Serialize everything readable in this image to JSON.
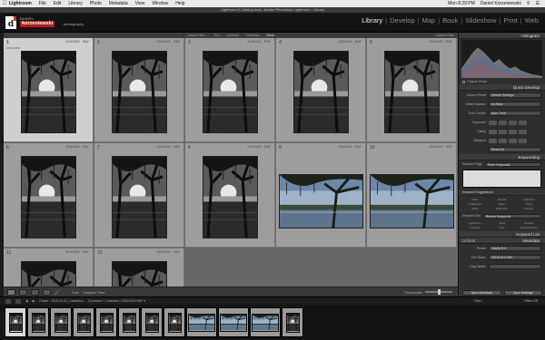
{
  "menubar": {
    "items": [
      {
        "label": "Lightroom",
        "bold": true
      },
      {
        "label": "File"
      },
      {
        "label": "Edit"
      },
      {
        "label": "Library"
      },
      {
        "label": "Photo"
      },
      {
        "label": "Metadata"
      },
      {
        "label": "View"
      },
      {
        "label": "Window"
      },
      {
        "label": "Help"
      }
    ],
    "clock": "Mon 8:29 PM",
    "user": "Daniel Korzeniewski"
  },
  "window": {
    "title": "Lightroom 6 Catalog.lrcat - Adobe Photoshop Lightroom - Library"
  },
  "identity": {
    "logo_letter": "d",
    "brand_top": "DANIEL",
    "brand_name": "korzeniewski",
    "brand_sub": "photography"
  },
  "modules": [
    "Library",
    "Develop",
    "Map",
    "Book",
    "Slideshow",
    "Print",
    "Web"
  ],
  "active_module": "Library",
  "filterbar": {
    "label": "Library Filter :",
    "tabs": [
      "Text",
      "Attribute",
      "Metadata",
      "None"
    ],
    "preset": "Custom Filter"
  },
  "grid": {
    "cells": [
      {
        "index": "1",
        "fname": "20151001",
        "ext": "RAF",
        "dims": "2000x3000",
        "orientation": "portrait",
        "selected": true
      },
      {
        "index": "2",
        "fname": "20151001",
        "ext": "RAF",
        "dims": "",
        "orientation": "portrait",
        "selected": false
      },
      {
        "index": "3",
        "fname": "20151001",
        "ext": "RAF",
        "dims": "",
        "orientation": "portrait",
        "selected": false
      },
      {
        "index": "4",
        "fname": "20151001",
        "ext": "RAF",
        "dims": "",
        "orientation": "portrait",
        "selected": false
      },
      {
        "index": "5",
        "fname": "20151001",
        "ext": "RAF",
        "dims": "",
        "orientation": "portrait",
        "selected": false
      },
      {
        "index": "6",
        "fname": "20151001",
        "ext": "RAF",
        "dims": "",
        "orientation": "portrait",
        "selected": false
      },
      {
        "index": "7",
        "fname": "20151001",
        "ext": "RAF",
        "dims": "",
        "orientation": "portrait",
        "selected": false
      },
      {
        "index": "8",
        "fname": "20151001",
        "ext": "RAF",
        "dims": "",
        "orientation": "portrait",
        "selected": false
      },
      {
        "index": "9",
        "fname": "20151001",
        "ext": "RAF",
        "dims": "",
        "orientation": "landscape",
        "selected": false
      },
      {
        "index": "10",
        "fname": "20151001",
        "ext": "RAF",
        "dims": "",
        "orientation": "landscape",
        "selected": false
      },
      {
        "index": "11",
        "fname": "20151001",
        "ext": "RAF",
        "dims": "",
        "orientation": "portrait",
        "selected": false
      },
      {
        "index": "12",
        "fname": "20151001",
        "ext": "RAF",
        "dims": "",
        "orientation": "portrait",
        "selected": false
      }
    ],
    "stars": "· · · · ·"
  },
  "toolbar": {
    "sort_label": "Sort:",
    "sort_value": "Capture Time",
    "thumbnails_label": "Thumbnails"
  },
  "right_panel": {
    "histogram": {
      "title": "Histogram",
      "original_photo": "Original Photo"
    },
    "quick_develop": {
      "title": "Quick Develop",
      "saved_preset_label": "Saved Preset",
      "saved_preset": "Default Settings",
      "white_balance_label": "White Balance",
      "white_balance": "As Shot",
      "tone_control_label": "Tone Control",
      "tone_control": "Auto Tone",
      "rows": [
        "Exposure",
        "Clarity",
        "Vibrance"
      ],
      "reset": "Reset All"
    },
    "keywording": {
      "title": "Keywording",
      "tags_label": "Keyword Tags",
      "tags_value": "Enter Keywords",
      "suggestions_label": "Keyword Suggestions",
      "suggestions": [
        "Oaks",
        "Florida",
        "Lightroom",
        "Landscape",
        "Water",
        "Trees",
        "Moss",
        "Reflection",
        "Sunset"
      ],
      "set_label": "Keyword Set",
      "set_value": "Recent Keywords",
      "set_items": [
        "Lightroom",
        "Label",
        "Presets",
        "Outdoor",
        "Tree",
        "Spanish Moss"
      ]
    },
    "keyword_list": {
      "title": "Keyword List"
    },
    "metadata": {
      "title": "Metadata",
      "preset_label": "Default",
      "preset_row_label": "Preset",
      "preset_row_value": "Clarity B ▾",
      "file_label": "File Name",
      "file_value": "20151001.RAF",
      "copy_label": "Copy Name",
      "copy_value": ""
    },
    "sync_metadata": "Sync Metadata",
    "sync_settings": "Sync Settings"
  },
  "filmbar": {
    "folder_label": "Folder : 2015-01-02_Casselton",
    "photos_info": "12 photos / 1 selected / 20151001.RAF ▾",
    "filter_label": "Filter :",
    "filters_off": "Filters Off"
  },
  "filmstrip": {
    "thumbs": [
      {
        "orientation": "portrait",
        "selected": true
      },
      {
        "orientation": "portrait"
      },
      {
        "orientation": "portrait"
      },
      {
        "orientation": "portrait"
      },
      {
        "orientation": "portrait"
      },
      {
        "orientation": "portrait"
      },
      {
        "orientation": "portrait"
      },
      {
        "orientation": "portrait"
      },
      {
        "orientation": "landscape"
      },
      {
        "orientation": "landscape"
      },
      {
        "orientation": "landscape"
      },
      {
        "orientation": "portrait"
      }
    ]
  }
}
